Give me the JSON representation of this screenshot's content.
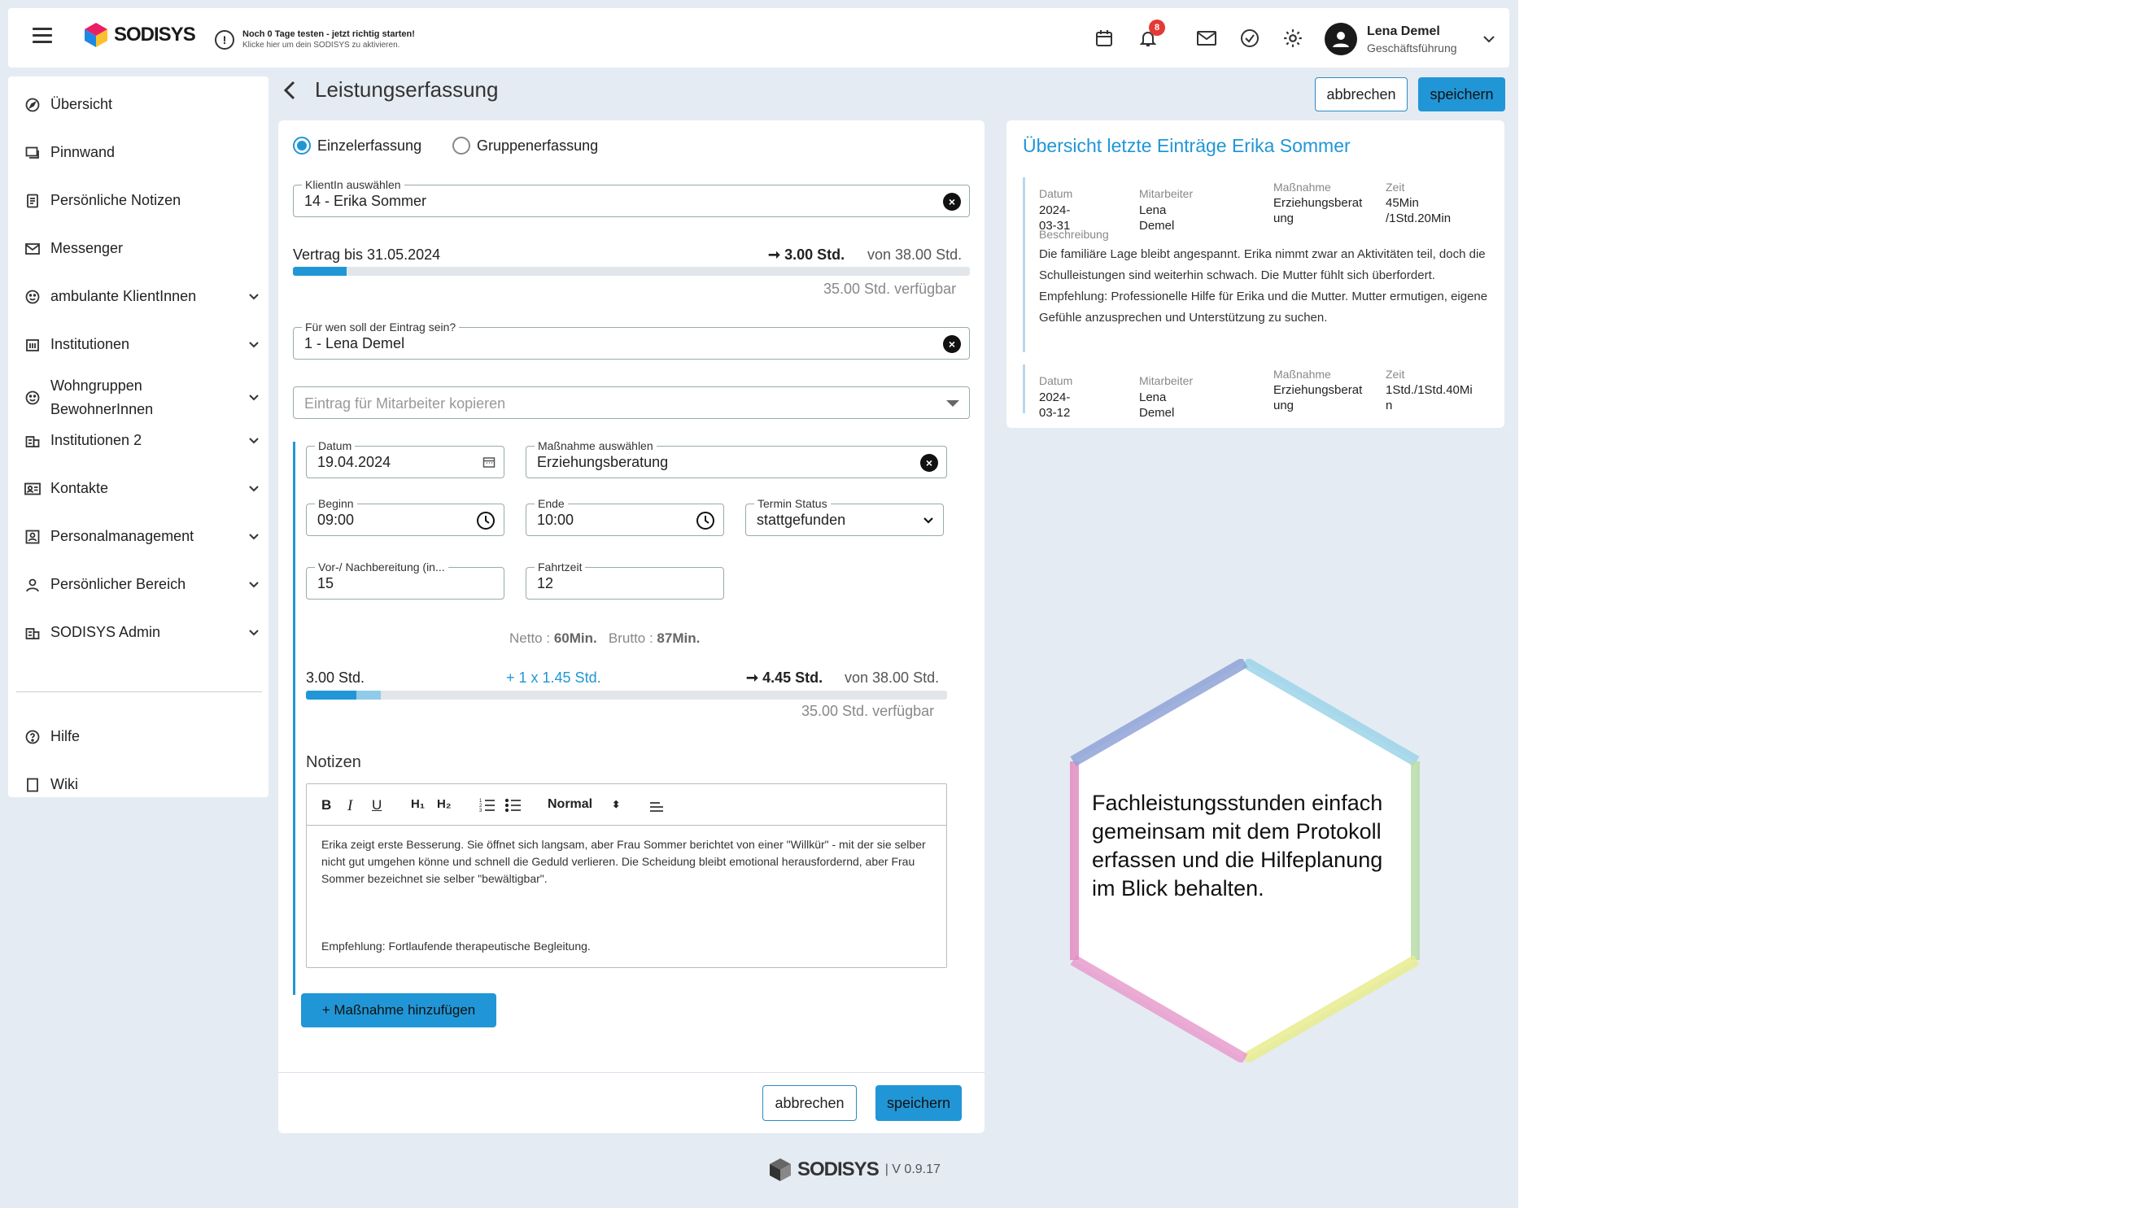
{
  "topbar": {
    "brand": "SODISYS",
    "trial_title": "Noch 0 Tage testen - jetzt richtig starten!",
    "trial_sub": "Klicke hier um dein SODISYS zu aktivieren.",
    "notification_count": "8",
    "user_name": "Lena Demel",
    "user_role": "Geschäftsführung"
  },
  "sidebar": {
    "items": [
      {
        "label": "Übersicht",
        "icon": "compass-icon"
      },
      {
        "label": "Pinnwand",
        "icon": "board-icon"
      },
      {
        "label": "Persönliche Notizen",
        "icon": "note-icon"
      },
      {
        "label": "Messenger",
        "icon": "mail-icon"
      },
      {
        "label": "ambulante KlientInnen",
        "icon": "smiley-icon"
      },
      {
        "label": "Institutionen",
        "icon": "building-icon"
      },
      {
        "label": "Wohngruppen",
        "label2": "BewohnerInnen",
        "icon": "smiley-icon"
      },
      {
        "label": "Institutionen 2",
        "icon": "buildings-icon"
      },
      {
        "label": "Kontakte",
        "icon": "contact-card-icon"
      },
      {
        "label": "Personalmanagement",
        "icon": "badge-icon"
      },
      {
        "label": "Persönlicher Bereich",
        "icon": "person-icon"
      },
      {
        "label": "SODISYS Admin",
        "icon": "buildings-icon"
      }
    ],
    "help": "Hilfe",
    "wiki": "Wiki"
  },
  "page": {
    "title": "Leistungserfassung",
    "cancel": "abbrechen",
    "save": "speichern"
  },
  "form": {
    "radio_single": "Einzelerfassung",
    "radio_group": "Gruppenerfassung",
    "client_label": "KlientIn auswählen",
    "client_value": "14 - Erika Sommer",
    "contract_text": "Vertrag bis 31.05.2024",
    "contract_arrow": "➞ 3.00 Std.",
    "contract_of": "von 38.00 Std.",
    "contract_available": "35.00 Std. verfügbar",
    "contract_progress": 0.079,
    "for_whom_label": "Für wen soll der Eintrag sein?",
    "for_whom_value": "1 - Lena Demel",
    "copy_placeholder": "Eintrag für Mitarbeiter kopieren",
    "date_label": "Datum",
    "date_value": "19.04.2024",
    "measure_label": "Maßnahme auswählen",
    "measure_value": "Erziehungsberatung",
    "begin_label": "Beginn",
    "begin_value": "09:00",
    "end_label": "Ende",
    "end_value": "10:00",
    "status_label": "Termin Status",
    "status_value": "stattgefunden",
    "prep_label": "Vor-/ Nachbereitung (in...",
    "prep_value": "15",
    "travel_label": "Fahrtzeit",
    "travel_value": "12",
    "netto_label": "Netto : ",
    "netto_value": "60Min.",
    "brutto_label": "Brutto : ",
    "brutto_value": "87Min.",
    "sum_current": "3.00 Std.",
    "sum_add": "+ 1 x 1.45 Std.",
    "sum_arrow": "➞ 4.45 Std.",
    "sum_of": "von 38.00 Std.",
    "sum_available": "35.00 Std. verfügbar",
    "sum_progress_base": 0.079,
    "sum_progress_add": 0.038,
    "notes_heading": "Notizen",
    "editor_format": "Normal",
    "notes_p1": "Erika zeigt erste Besserung. Sie öffnet sich langsam, aber Frau Sommer berichtet von einer \"Willkür\" - mit der sie selber nicht gut umgehen könne und schnell die Geduld verlieren. Die Scheidung bleibt emotional herausfordernd, aber Frau Sommer bezeichnet sie selber \"bewältigbar\".",
    "notes_p2": "Empfehlung: Fortlaufende therapeutische Begleitung.",
    "add_measure": "+ Maßnahme hinzufügen",
    "bottom_cancel": "abbrechen",
    "bottom_save": "speichern"
  },
  "overview": {
    "title": "Übersicht letzte Einträge Erika Sommer",
    "col_date": "Datum",
    "col_staff": "Mitarbeiter",
    "col_measure": "Maßnahme",
    "col_time": "Zeit",
    "desc_label": "Beschreibung",
    "entries": [
      {
        "date": "2024-03-31",
        "staff": "Lena Demel",
        "measure_l1": "Erziehungsberat",
        "measure_l2": "ung",
        "time_l1": "45Min",
        "time_l2": "/1Std.20Min",
        "description": "Die familiäre Lage bleibt angespannt. Erika nimmt zwar an Aktivitäten teil, doch die Schulleistungen sind weiterhin schwach. Die Mutter fühlt sich überfordert. Empfehlung: Professionelle Hilfe für Erika und die Mutter. Mutter ermutigen, eigene Gefühle anzusprechen und Unterstützung zu suchen."
      },
      {
        "date": "2024-03-12",
        "staff": "Lena Demel",
        "measure_l1": "Erziehungsberat",
        "measure_l2": "ung",
        "time_l1": "1Std./1Std.40Mi",
        "time_l2": "n"
      }
    ]
  },
  "promo": {
    "text": "Fachleistungsstunden einfach gemeinsam mit dem Protokoll erfassen und die Hilfeplanung im Blick behalten."
  },
  "footer": {
    "brand": "SODISYS",
    "version": "| V 0.9.17"
  },
  "colors": {
    "accent": "#2196d6",
    "background": "#e4ebf3",
    "danger": "#e53935"
  }
}
